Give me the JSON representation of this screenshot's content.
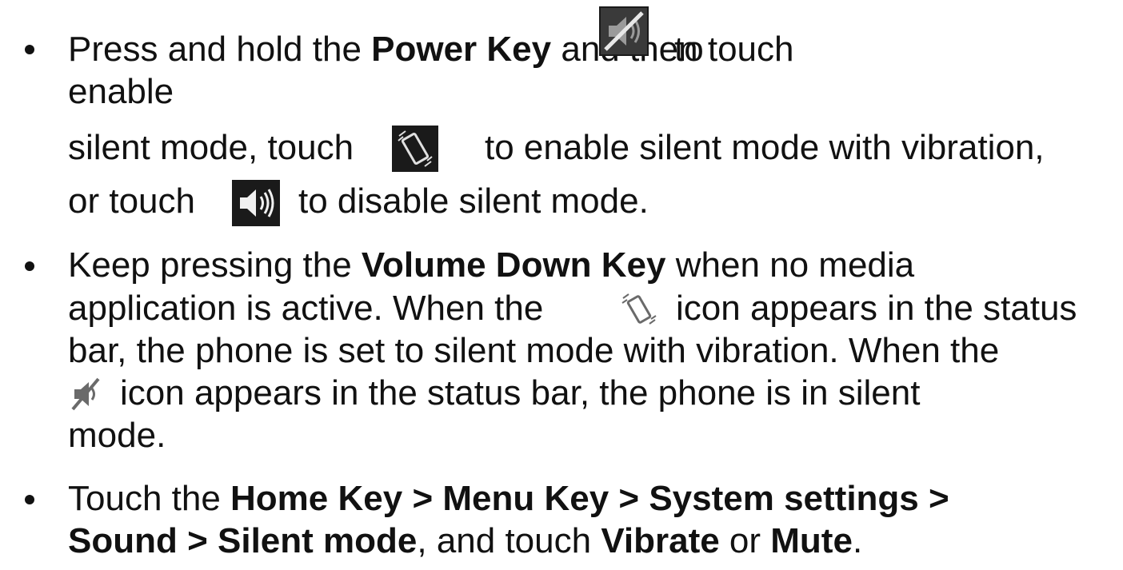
{
  "bullets": [
    {
      "l1_a": "Press and hold the ",
      "l1_b": "Power Key",
      "l1_c": " and then touch",
      "l1_d": "to",
      "l2": "enable",
      "l3_a": "silent mode, touch",
      "l3_b": "to enable silent mode with vibration,",
      "l4_a": "or touch",
      "l4_b": "to disable silent mode."
    },
    {
      "l1_a": "Keep pressing the ",
      "l1_b": "Volume Down Key",
      "l1_c": " when no media",
      "l2_a": "application is active. When the",
      "l2_b": "icon appears in the status",
      "l3": "bar, the phone is set to silent mode with vibration. When the",
      "l4": "icon appears in the status bar, the phone is in silent",
      "l5": "mode."
    },
    {
      "l1_a": "Touch the ",
      "l1_b": "Home Key > Menu Key > System settings >",
      "l2_a": "Sound > Silent mode",
      "l2_b": ", and touch ",
      "l2_c": "Vibrate",
      "l2_d": " or ",
      "l2_e": "Mute",
      "l2_f": "."
    }
  ],
  "icons": {
    "silent_button": "speaker-muted-icon",
    "vibrate_button": "vibrate-phone-icon",
    "sound_button": "speaker-on-icon",
    "vibrate_status": "vibrate-status-icon",
    "silent_status": "muted-status-icon"
  },
  "colors": {
    "text": "#111111",
    "icon_bg": "#1a1a1a"
  }
}
